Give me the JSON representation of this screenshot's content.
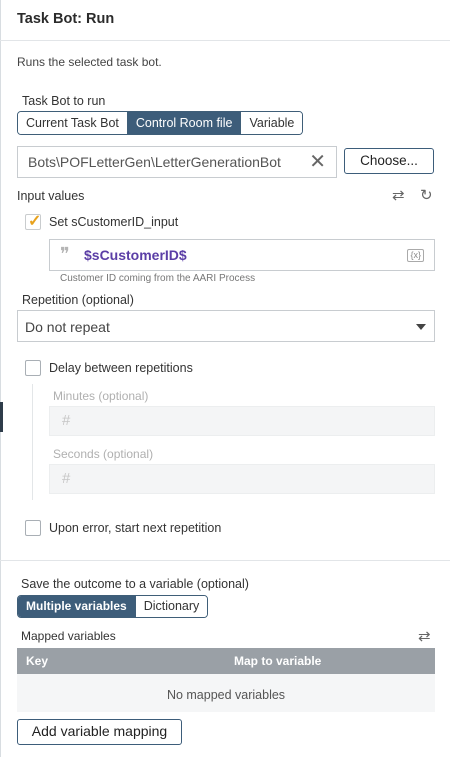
{
  "header": {
    "title": "Task Bot: Run",
    "description": "Runs the selected task bot."
  },
  "taskbot": {
    "label": "Task Bot to run",
    "options": [
      "Current Task Bot",
      "Control Room file",
      "Variable"
    ],
    "selected": "Control Room file",
    "file_value": "Bots\\POFLetterGen\\LetterGenerationBot",
    "clear_icon": "close-icon",
    "choose_label": "Choose..."
  },
  "inputs": {
    "label": "Input values",
    "icons": [
      "swap-icon",
      "refresh-icon"
    ],
    "param": {
      "checked": true,
      "label": "Set sCustomerID_input",
      "value": "$sCustomerID$",
      "var_badge": "{x}",
      "hint": "Customer ID coming from the AARI Process"
    }
  },
  "repetition": {
    "label": "Repetition (optional)",
    "value": "Do not repeat",
    "delay_label": "Delay between repetitions",
    "delay_checked": false,
    "minutes_label": "Minutes (optional)",
    "minutes_placeholder": "#",
    "seconds_label": "Seconds (optional)",
    "seconds_placeholder": "#",
    "on_error_label": "Upon error, start next repetition",
    "on_error_checked": false
  },
  "outcome": {
    "label": "Save the outcome to a variable (optional)",
    "options": [
      "Multiple variables",
      "Dictionary"
    ],
    "selected": "Multiple variables",
    "mapped_label": "Mapped variables",
    "columns": [
      "Key",
      "Map to variable"
    ],
    "empty_text": "No mapped variables",
    "add_label": "Add variable mapping"
  },
  "colors": {
    "accent": "#3d5d7a",
    "check": "#e8a21d",
    "variable": "#5b3ea6"
  }
}
